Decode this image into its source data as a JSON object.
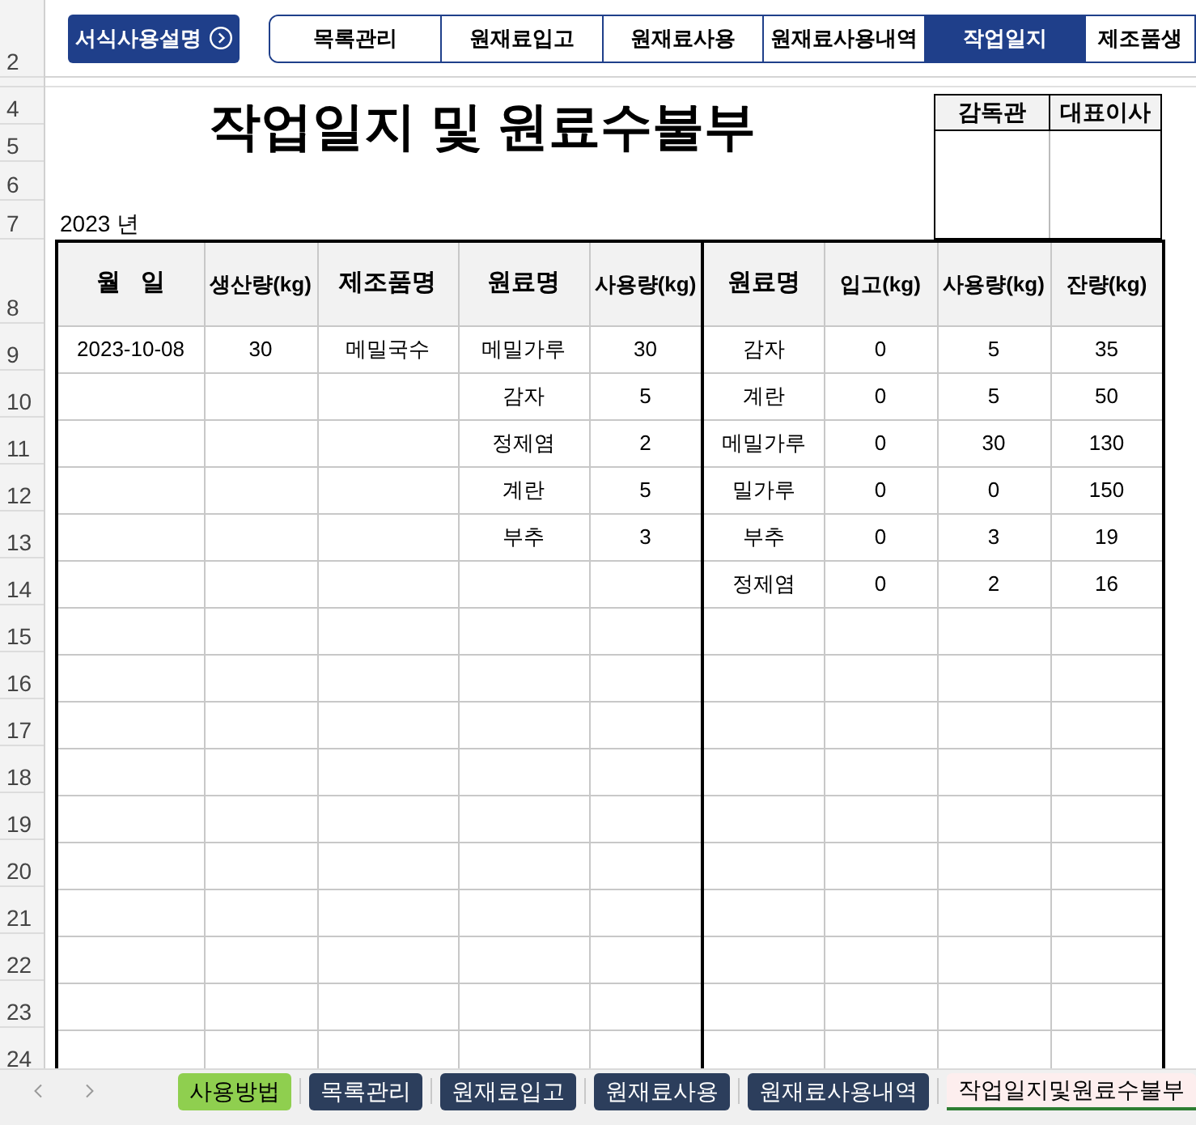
{
  "format_button": {
    "label": "서식사용설명"
  },
  "nav_tabs": [
    {
      "label": "목록관리",
      "selected": false
    },
    {
      "label": "원재료입고",
      "selected": false
    },
    {
      "label": "원재료사용",
      "selected": false
    },
    {
      "label": "원재료사용내역",
      "selected": false
    },
    {
      "label": "작업일지",
      "selected": true
    },
    {
      "label": "제조품생",
      "selected": false
    }
  ],
  "row_numbers": [
    "2",
    "4",
    "5",
    "6",
    "7",
    "8",
    "9",
    "10",
    "11",
    "12",
    "13",
    "14",
    "15",
    "16",
    "17",
    "18",
    "19",
    "20",
    "21",
    "22",
    "23",
    "24"
  ],
  "title": "작업일지 및 원료수불부",
  "year": "2023 년",
  "approvals": [
    "감독관",
    "대표이사"
  ],
  "table": {
    "columns": [
      "월   일",
      "생산량(kg)",
      "제조품명",
      "원료명",
      "사용량(kg)",
      "원료명",
      "입고(kg)",
      "사용량(kg)",
      "잔량(kg)"
    ],
    "production_rows": [
      {
        "date": "2023-10-08",
        "output": "30",
        "product": "메밀국수",
        "material": "메밀가루",
        "used": "30"
      },
      {
        "material": "감자",
        "used": "5"
      },
      {
        "material": "정제염",
        "used": "2"
      },
      {
        "material": "계란",
        "used": "5"
      },
      {
        "material": "부추",
        "used": "3"
      }
    ],
    "inventory_rows": [
      {
        "material": "감자",
        "received": "0",
        "used": "5",
        "balance": "35"
      },
      {
        "material": "계란",
        "received": "0",
        "used": "5",
        "balance": "50"
      },
      {
        "material": "메밀가루",
        "received": "0",
        "used": "30",
        "balance": "130"
      },
      {
        "material": "밀가루",
        "received": "0",
        "used": "0",
        "balance": "150"
      },
      {
        "material": "부추",
        "received": "0",
        "used": "3",
        "balance": "19"
      },
      {
        "material": "정제염",
        "received": "0",
        "used": "2",
        "balance": "16"
      }
    ]
  },
  "sheet_tabs": [
    {
      "label": "사용방법",
      "selected": false,
      "color": "#8fcf4f"
    },
    {
      "label": "목록관리",
      "selected": false,
      "color": "#2c3e5c"
    },
    {
      "label": "원재료입고",
      "selected": false,
      "color": "#2c3e5c"
    },
    {
      "label": "원재료사용",
      "selected": false,
      "color": "#2c3e5c"
    },
    {
      "label": "원재료사용내역",
      "selected": false,
      "color": "#2c3e5c"
    },
    {
      "label": "작업일지및원료수불부",
      "selected": true,
      "color": "#fdeeee"
    }
  ]
}
